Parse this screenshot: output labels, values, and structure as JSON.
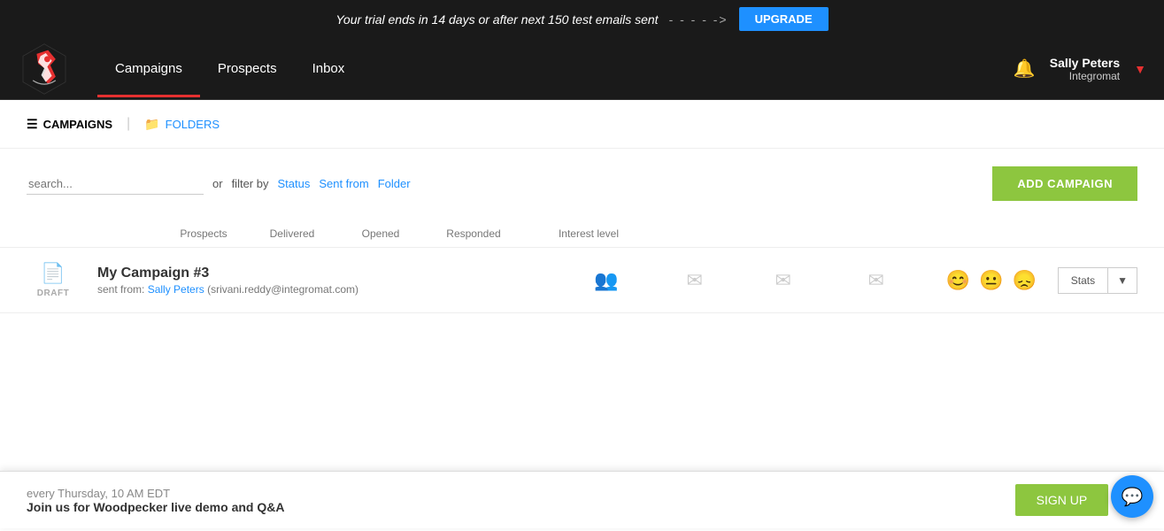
{
  "banner": {
    "message": "Your trial ends in 14 days or after next 150 test emails sent",
    "dashes": "- - - - ->",
    "upgrade_label": "UPGRADE"
  },
  "header": {
    "nav": [
      {
        "id": "campaigns",
        "label": "Campaigns",
        "active": true
      },
      {
        "id": "prospects",
        "label": "Prospects",
        "active": false
      },
      {
        "id": "inbox",
        "label": "Inbox",
        "active": false
      }
    ],
    "user": {
      "name": "Sally Peters",
      "company": "Integromat"
    }
  },
  "tabs": {
    "campaigns_label": "CAMPAIGNS",
    "folders_label": "FOLDERS"
  },
  "filter": {
    "search_placeholder": "search...",
    "or_label": "or",
    "filter_by_label": "filter by",
    "status_label": "Status",
    "sent_from_label": "Sent from",
    "folder_label": "Folder",
    "add_campaign_label": "ADD CAMPAIGN"
  },
  "table": {
    "columns": {
      "prospects": "Prospects",
      "delivered": "Delivered",
      "opened": "Opened",
      "responded": "Responded",
      "interest_level": "Interest level"
    }
  },
  "campaigns": [
    {
      "id": "campaign-1",
      "name": "My Campaign #3",
      "sent_from_label": "sent from:",
      "sender_name": "Sally Peters",
      "sender_email": "(srivani.reddy@integromat.com)",
      "status": "DRAFT"
    }
  ],
  "popup": {
    "schedule": "every Thursday, 10 AM EDT",
    "title": "Join us for Woodpecker live demo and Q&A",
    "signup_label": "SIGN UP"
  },
  "stats_btn": "Stats"
}
